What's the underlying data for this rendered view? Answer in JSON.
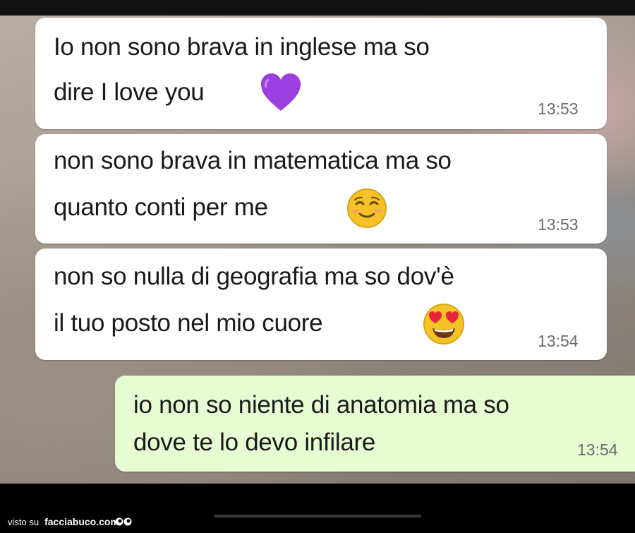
{
  "messages": [
    {
      "direction": "incoming",
      "lines": [
        "Io non sono brava in inglese ma so",
        "dire I love you"
      ],
      "emoji": "purple-heart",
      "time": "13:53"
    },
    {
      "direction": "incoming",
      "lines": [
        "non sono brava in matematica ma so",
        "quanto conti per me"
      ],
      "emoji": "relieved-face",
      "time": "13:53"
    },
    {
      "direction": "incoming",
      "lines": [
        "non so nulla di geografia ma so dov'è",
        "il tuo posto nel mio cuore"
      ],
      "emoji": "heart-eyes-face",
      "time": "13:54"
    },
    {
      "direction": "outgoing",
      "lines": [
        "io non so niente di anatomia ma so",
        "dove te lo devo infilare"
      ],
      "emoji": null,
      "time": "13:54"
    }
  ],
  "footer": {
    "prefix": "visto su",
    "site": "facciabuco.com"
  },
  "colors": {
    "incoming_bubble": "#ffffff",
    "outgoing_bubble": "#e6fcd3",
    "purple_heart": "#9b3fe0",
    "emoji_yellow": "#f5c227"
  }
}
